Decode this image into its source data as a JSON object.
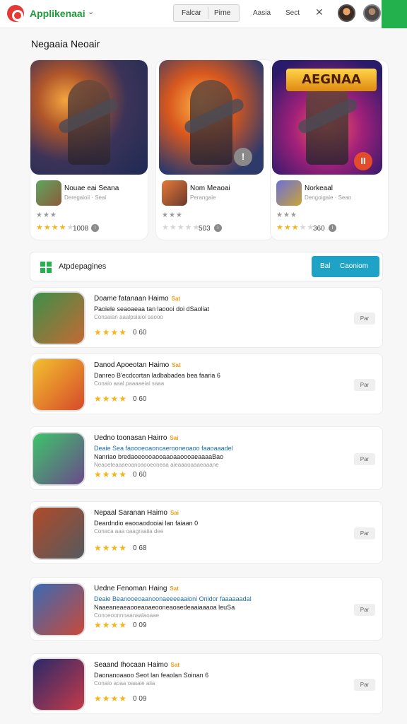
{
  "header": {
    "brand": "Applikenaai",
    "brand_caret": "⌄",
    "segments": [
      "Falcar",
      "Pirne"
    ],
    "nav": [
      "Aasia",
      "Sect"
    ],
    "close": "✕"
  },
  "section_title": "Negaaia Neoair",
  "featured": [
    {
      "banner": "",
      "corner": "",
      "name": "Nouae eai Seana",
      "sub": "Deregaioii · Seai",
      "stars_on": 4,
      "count": "1008"
    },
    {
      "banner": "",
      "corner": "!",
      "name": "Nom Meaoai",
      "sub": "Perangaie",
      "stars_on": 0,
      "count": "503"
    },
    {
      "banner": "AEGNAA",
      "corner": "II",
      "name": "Norkeaal",
      "sub": "Dengoigaie · Sean",
      "stars_on": 3,
      "count": "360"
    }
  ],
  "pages_bar": {
    "label": "Atpdepagines",
    "button_left": "Bal",
    "button_right": "Caoniom"
  },
  "list": [
    {
      "title": "Doame fatanaan Haimo",
      "tag": "Sat",
      "lines": [
        {
          "text": "Paoiele seaoaeaa tan laoooi doi dSaoliat",
          "style": "dark"
        },
        {
          "text": "Consaian aaalpsiaioi saooo",
          "style": "grey"
        }
      ],
      "stars": "★★★★",
      "count": "0 60",
      "btn": "Par"
    },
    {
      "title": "Danod Apoeotan Haimo",
      "tag": "Sat",
      "lines": [
        {
          "text": "Danreo B'ecdcortan ladbabadea bea faaria 6",
          "style": "dark"
        },
        {
          "text": "Conaio aaal paaaaeiai saaa",
          "style": "grey"
        }
      ],
      "stars": "★★★★",
      "count": "0 60",
      "btn": "Par"
    },
    {
      "title": "Uedno toonasan Hairro",
      "tag": "Sai",
      "lines": [
        {
          "text": "Deaie Sea faoooeoaoncaerooneoaoo faaoaaadel",
          "style": "blue"
        },
        {
          "text": "Nanriao bredaoeoooaooaaoaaoooaeaaaaBao",
          "style": "dark"
        },
        {
          "text": "Neaoeteaaaeoanoaooeoneaa aieaaaoaaaeaaane",
          "style": "grey"
        }
      ],
      "stars": "★★★★",
      "count": "0 60",
      "btn": "Par"
    },
    {
      "title": "Nepaal Saranan Haimo",
      "tag": "Sai",
      "lines": [
        {
          "text": "Deardndio eaooaodooiai lan faiaan 0",
          "style": "dark"
        },
        {
          "text": "Conaca aaa oaagraaiia dee",
          "style": "grey"
        }
      ],
      "stars": "★★★★",
      "count": "0 68",
      "btn": "Par"
    },
    {
      "title": "Uedne Fenoman Haing",
      "tag": "Sat",
      "lines": [
        {
          "text": "Deaie Beanooeoaanoonaeeeeaaioni Onidor faaaaaadal",
          "style": "blue"
        },
        {
          "text": "Naaeaneaeaooeaoaeooneaoaedeaaiaaaoa leuSa",
          "style": "dark"
        },
        {
          "text": "Conoeoonnnaanaalaoaae",
          "style": "grey"
        }
      ],
      "stars": "★★★★",
      "count": "0 09",
      "btn": "Par"
    },
    {
      "title": "Seaand Ihocaan Haimo",
      "tag": "Sat",
      "lines": [
        {
          "text": "Daonanoaaoo Seot lan feaolan Soinan 6",
          "style": "dark"
        },
        {
          "text": "Conaio aoaa oaaaie aiia",
          "style": "grey"
        }
      ],
      "stars": "★★★★",
      "count": "0 09",
      "btn": "Par"
    }
  ]
}
